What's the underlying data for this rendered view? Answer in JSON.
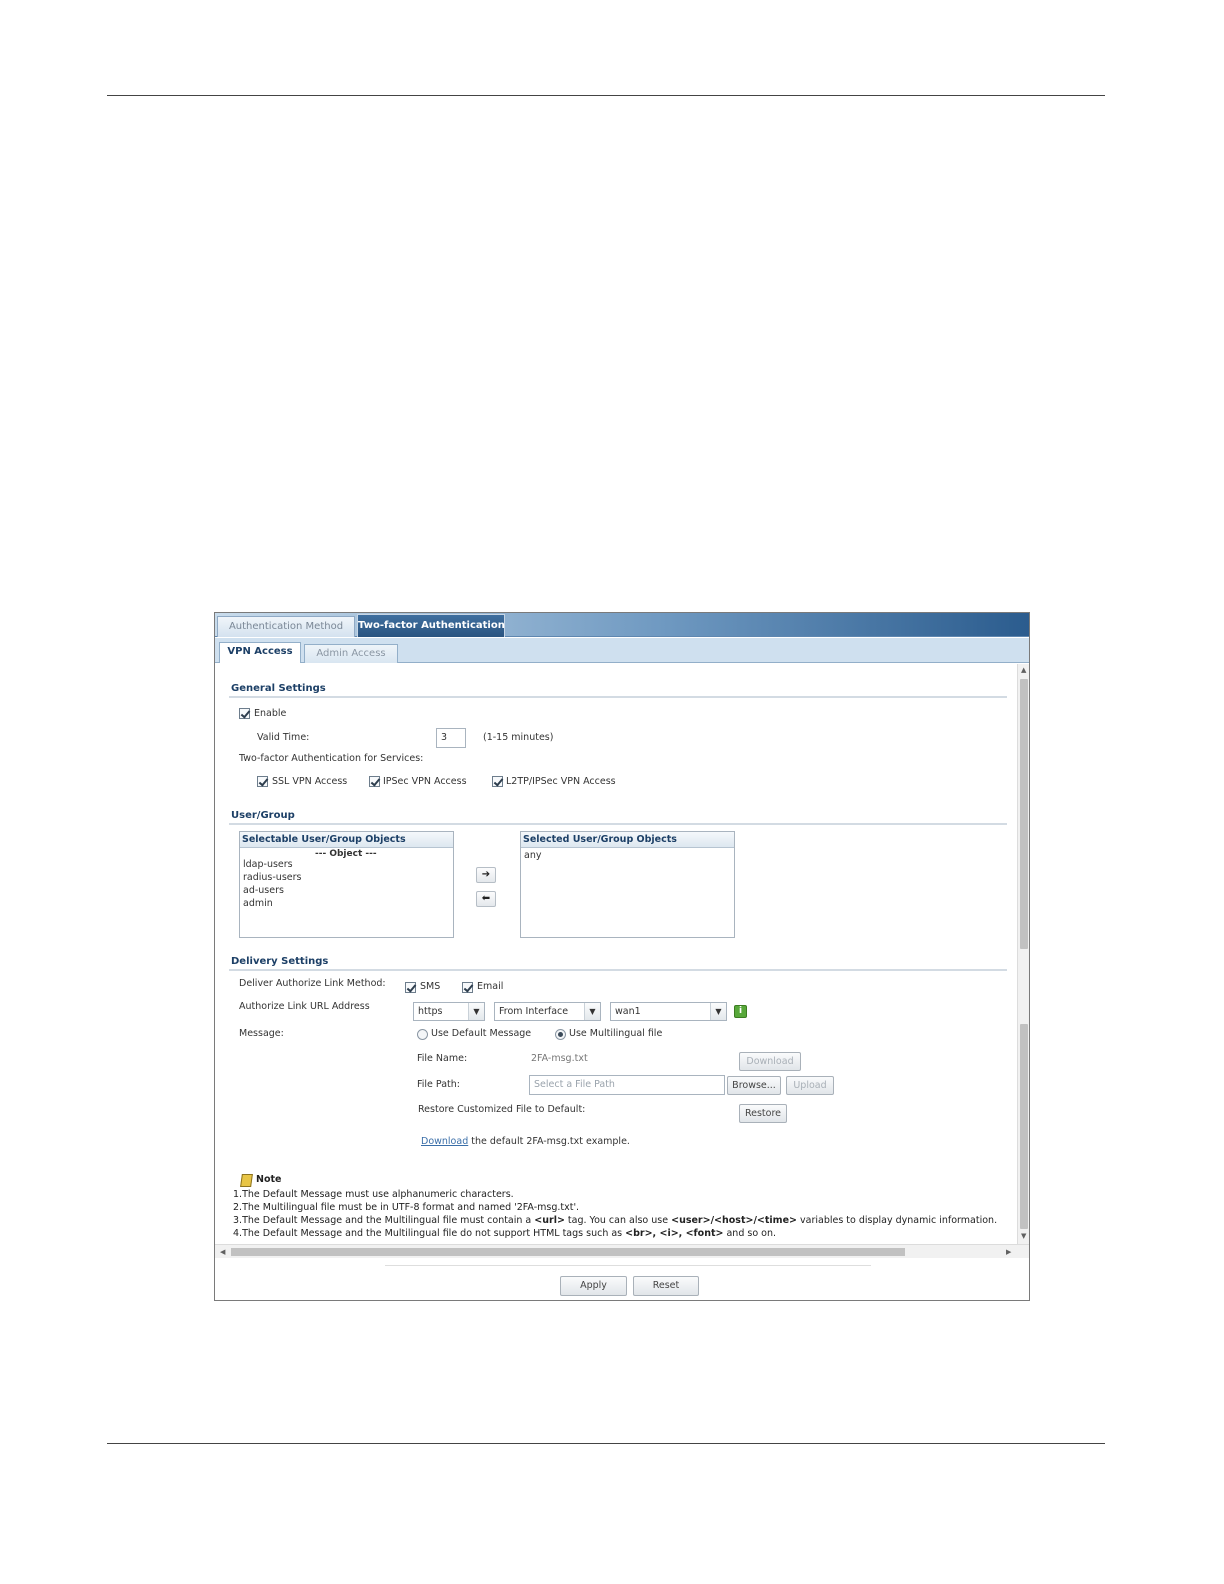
{
  "tabs_top": [
    {
      "label": "Authentication Method",
      "active": false
    },
    {
      "label": "Two-factor Authentication",
      "active": true
    }
  ],
  "tabs_sub": [
    {
      "label": "VPN Access",
      "active": true
    },
    {
      "label": "Admin Access",
      "active": false
    }
  ],
  "general": {
    "title": "General Settings",
    "enable_label": "Enable",
    "valid_time_label": "Valid Time:",
    "valid_time_value": "3",
    "valid_time_hint": "(1-15 minutes)",
    "services_label": "Two-factor Authentication for Services:",
    "services": [
      "SSL VPN Access",
      "IPSec VPN Access",
      "L2TP/IPSec VPN Access"
    ]
  },
  "user_group": {
    "title": "User/Group",
    "selectable_header": "Selectable User/Group Objects",
    "object_caption": "--- Object ---",
    "selectable_items": [
      "ldap-users",
      "radius-users",
      "ad-users",
      "admin"
    ],
    "selected_header": "Selected User/Group Objects",
    "selected_items": [
      "any"
    ],
    "add_arrow": "➔",
    "remove_arrow": "⬅"
  },
  "delivery": {
    "title": "Delivery Settings",
    "method_label": "Deliver Authorize Link Method:",
    "method_sms": "SMS",
    "method_email": "Email",
    "url_label": "Authorize Link URL Address",
    "protocol": "https",
    "source": "From Interface",
    "interface": "wan1",
    "info_glyph": "i",
    "message_label": "Message:",
    "radio_default": "Use Default Message",
    "radio_multi": "Use Multilingual file",
    "file_name_label": "File Name:",
    "file_name_value": "2FA-msg.txt",
    "download_btn": "Download",
    "file_path_label": "File Path:",
    "file_path_placeholder": "Select a File Path",
    "browse_btn": "Browse...",
    "upload_btn": "Upload",
    "restore_label": "Restore Customized File to Default:",
    "restore_btn": "Restore",
    "download_link": "Download",
    "download_text": "the default 2FA-msg.txt example."
  },
  "notes": {
    "title": "Note",
    "line1": "1.The Default Message must use alphanumeric characters.",
    "line2": "2.The Multilingual file must be in UTF-8 format and named '2FA-msg.txt'.",
    "line3a": "3.The Default Message and the Multilingual file must contain a ",
    "line3b": "<url>",
    "line3c": " tag. You can also use ",
    "line3d": "<user>/<host>/<time>",
    "line3e": " variables to display dynamic information.",
    "line4a": "4.The Default Message and the Multilingual file do not support HTML tags such as ",
    "line4b": "<br>, <i>, <font>",
    "line4c": " and so on."
  },
  "footer": {
    "apply": "Apply",
    "reset": "Reset"
  }
}
